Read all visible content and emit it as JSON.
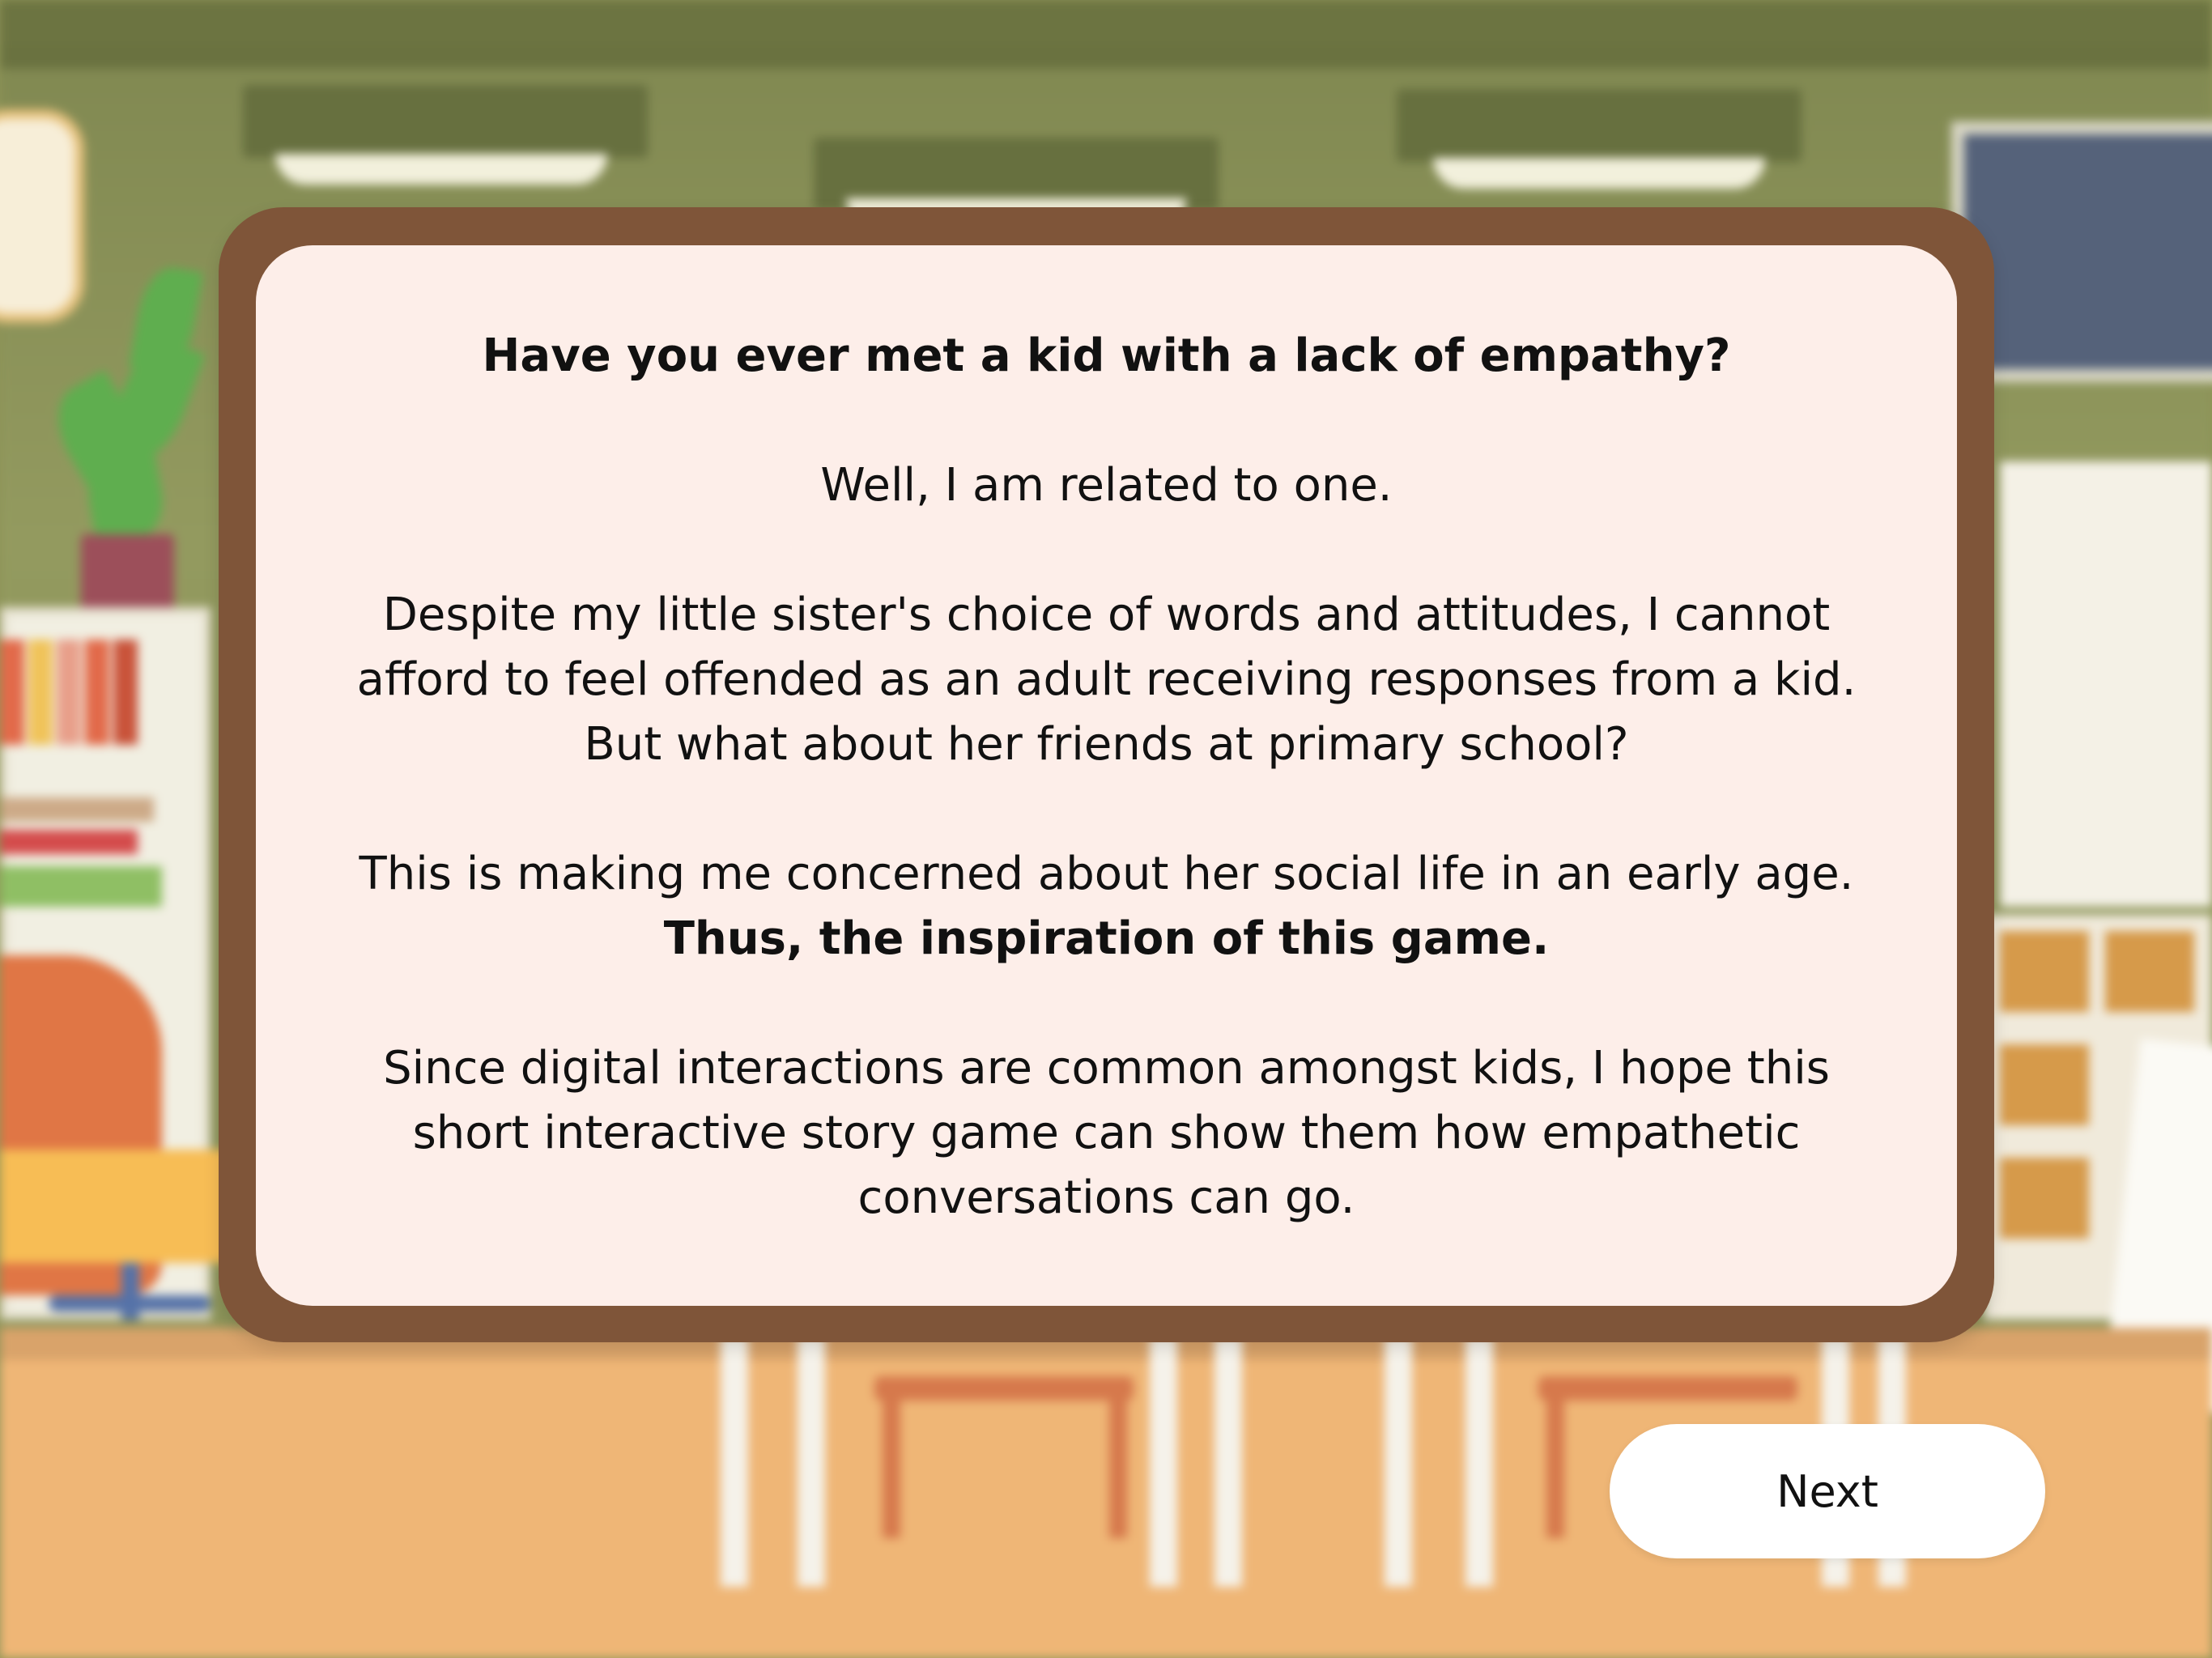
{
  "dialog": {
    "question": "Have you ever met a kid with a lack of empathy?",
    "line1": "Well, I am related to one.",
    "para2": {
      "l1": "Despite my little sister's choice of words and attitudes, I cannot",
      "l2": "afford to feel offended as an adult receiving responses from a kid.",
      "l3": "But what about her friends at primary school?"
    },
    "para3": {
      "l1": "This is making me concerned about her social life in an early age.",
      "l2_bold": "Thus, the inspiration of this game."
    },
    "para4": {
      "l1": "Since digital interactions are common amongst kids, I hope this",
      "l2": "short interactive story game can show them how empathetic",
      "l3": "conversations can go."
    }
  },
  "controls": {
    "next_label": "Next"
  },
  "colors": {
    "frame": "#7f5539",
    "card": "#fdeee9",
    "button": "#ffffff",
    "wall": "#8d9357",
    "floor": "#efb676"
  }
}
